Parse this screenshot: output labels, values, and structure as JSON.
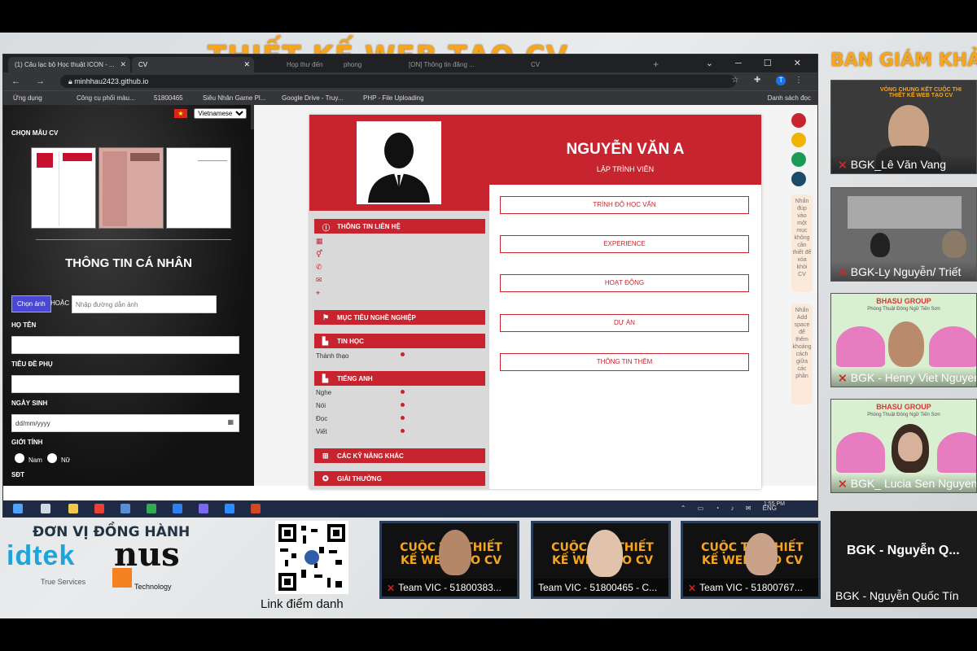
{
  "event_title": "THIẾT KẾ WEB TẠO CV",
  "jury_title": "BAN GIÁM KHẢO",
  "browser": {
    "tabs": [
      "(1) Câu lạc bộ Học thuật ICON - ...",
      "CV",
      "Họp thư đến",
      "phong",
      "[ON] Thông tin đăng ...",
      "CV"
    ],
    "url": "minhhau2423.github.io",
    "bookmarks": [
      "Ứng dụng",
      "Công cụ phối màu...",
      "51800465",
      "Siêu Nhân Game Pl...",
      "Google Drive - Truy...",
      "PHP - File Uploading"
    ],
    "reading_list": "Danh sách đọc",
    "profile_initial": "T"
  },
  "editor": {
    "language": "Vietnamese",
    "choose_template": "CHỌN MẪU CV",
    "personal_info_heading": "THÔNG TIN CÁ NHÂN",
    "choose_image_button": "Chọn ảnh",
    "or_label": "HOẶC",
    "image_url_placeholder": "Nhập đường dẫn ảnh",
    "name_label": "HỌ TÊN",
    "subtitle_label": "TIÊU ĐỀ PHỤ",
    "dob_label": "NGÀY SINH",
    "dob_placeholder": "dd/mm/yyyy",
    "gender_label": "GIỚI TÍNH",
    "gender_male": "Nam",
    "gender_female": "Nữ",
    "phone_label": "SĐT"
  },
  "cv": {
    "name": "NGUYỄN VĂN A",
    "role": "LẬP TRÌNH VIÊN",
    "contact_title": "THÔNG TIN LIÊN HỆ",
    "career_goal_title": "MỤC TIÊU NGHỀ NGHIỆP",
    "it_title": "TIN HỌC",
    "it_skill": "Thành thạo",
    "english_title": "TIẾNG ANH",
    "english_skills": [
      "Nghe",
      "Nói",
      "Đọc",
      "Viết"
    ],
    "other_skills_title": "CÁC KỸ NĂNG KHÁC",
    "awards_title": "GIẢI THƯỞNG",
    "right_sections": [
      "TRÌNH ĐỘ HỌC VẤN",
      "EXPERIENCE",
      "HOẠT ĐỘNG",
      "DỰ ÁN",
      "THÔNG TIN THÊM"
    ],
    "theme_colors": [
      "#c8242f",
      "#f0b400",
      "#1a9a52",
      "#1b4a6b"
    ],
    "hint_delete": "Nhấn đúp vào một mục không cần thiết để xóa khỏi CV",
    "hint_space": "Nhấn Add space để thêm khoảng cách giữa các phần"
  },
  "taskbar": {
    "lang": "ENG",
    "time": "1:55 PM"
  },
  "jury": [
    {
      "name": "BGK_Lê Văn Vang"
    },
    {
      "name": "BGK-Ly Nguyễn/ Triết"
    },
    {
      "name": "BGK - Henry Viet Nguyen"
    },
    {
      "name": "BGK_ Lucia Sen Nguyen"
    }
  ],
  "jury_poster": "VÒNG CHUNG KẾT CUỘC THI THIẾT KẾ WEB TẠO CV",
  "bhasu": {
    "name": "BHASU GROUP",
    "sub": "Phòng Thuật Đông Ngữ Tiến Sơn"
  },
  "sponsors": {
    "title": "ĐƠN VỊ ĐỒNG HÀNH",
    "idtek": "idtek",
    "idtek_sub": "True Services",
    "nus": "nus",
    "nus_sub": "Technology"
  },
  "qr_label": "Link điểm danh",
  "teams": [
    {
      "name": "Team VIC - 51800383..."
    },
    {
      "name": "Team VIC - 51800465 - C..."
    },
    {
      "name": "Team VIC - 51800767..."
    }
  ],
  "team_banner": "CUỘC THI THIẾT KẾ WEB TẠO CV",
  "last_tile": {
    "big": "BGK - Nguyễn Q...",
    "small": "BGK - Nguyễn Quốc Tín"
  },
  "colors": {
    "accent_orange": "#f7a51c",
    "cv_red": "#c8242f"
  }
}
